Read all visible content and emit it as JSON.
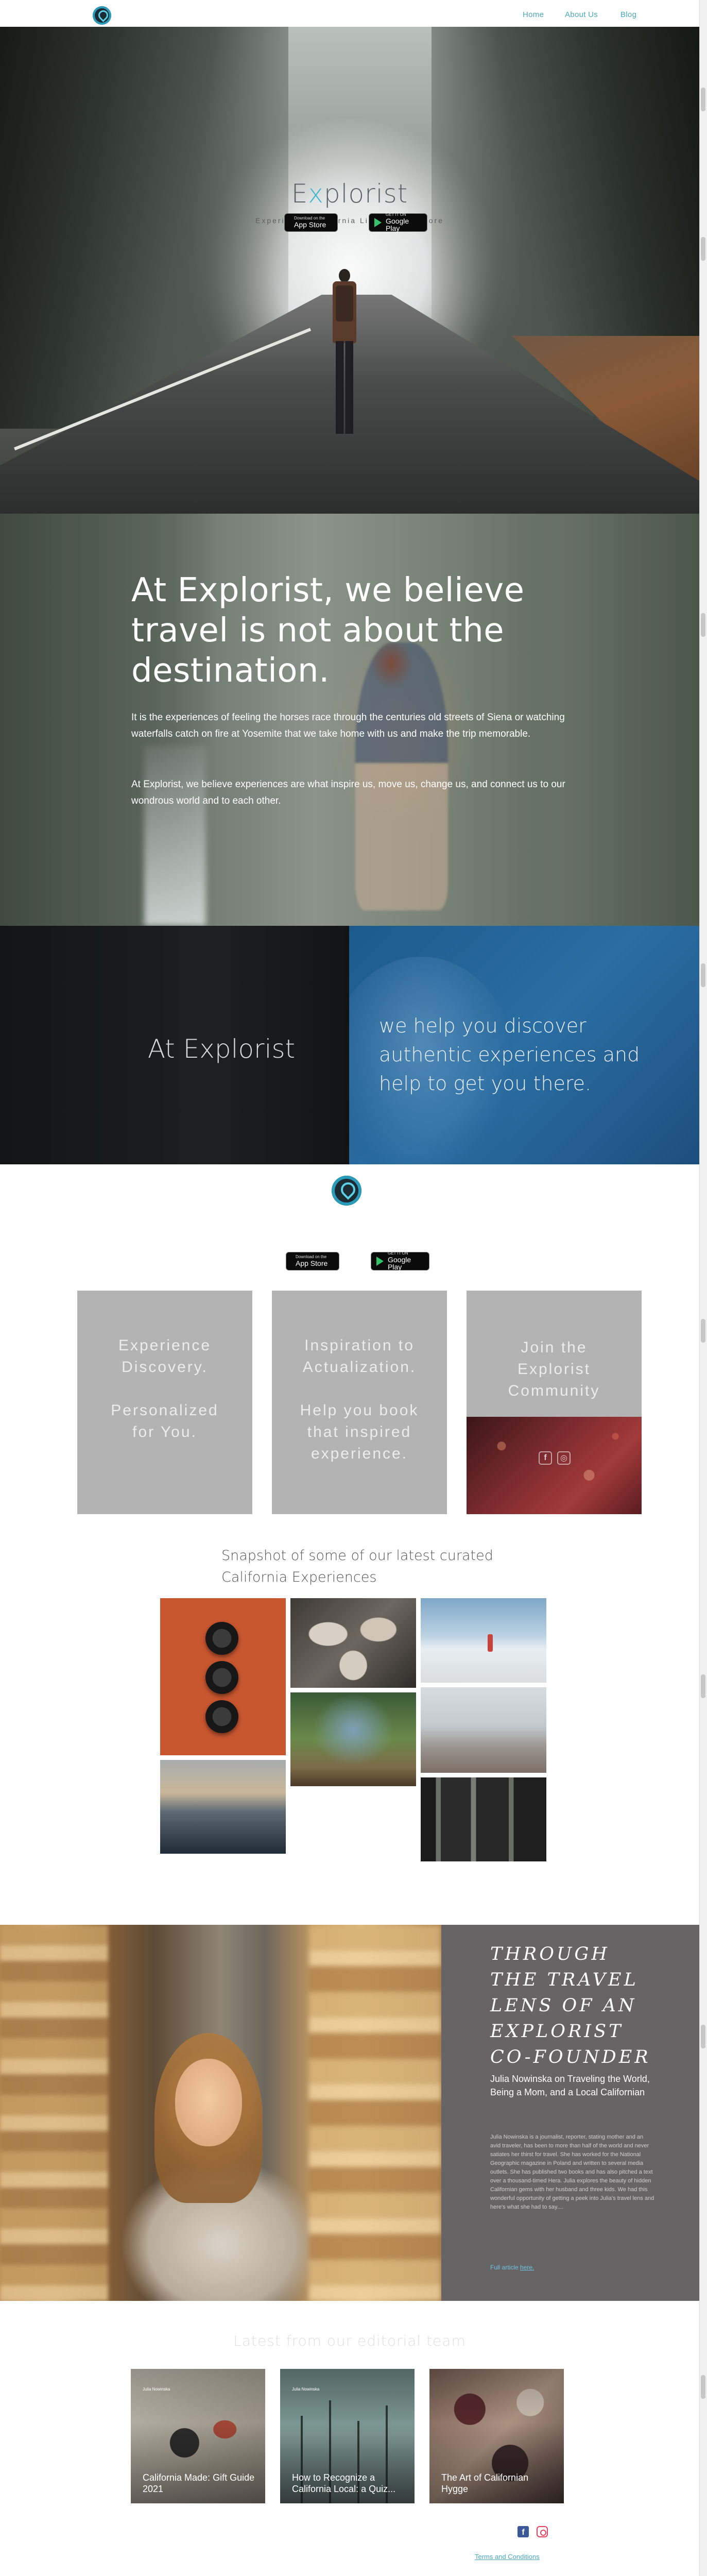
{
  "header": {
    "logo_alt": "Explorist logo",
    "nav": [
      "Home",
      "About Us",
      "Blog"
    ]
  },
  "hero": {
    "title_prefix": "E",
    "title_accent": "x",
    "title_suffix": "plorist",
    "subtitle": "Experience California Like Never Before",
    "app_store": {
      "small": "Download on the",
      "big": "App Store"
    },
    "google_play": {
      "small": "GET IT ON",
      "big": "Google Play"
    }
  },
  "belief": {
    "heading": "At Explorist, we believe travel is not about the destination.",
    "paragraph_1": "It is the experiences of feeling the horses race through the centuries old streets of Siena or watching waterfalls catch on fire at Yosemite that we take home with us and make the trip memorable.",
    "paragraph_2": "At Explorist, we believe experiences are what inspire us, move us, change us, and connect us to our wondrous world and to each other."
  },
  "split": {
    "left": "At Explorist",
    "right": "we help you discover authentic experiences and help to get you there."
  },
  "badges": {
    "app_store": {
      "small": "Download on the",
      "big": "App Store"
    },
    "google_play": {
      "small": "GET IT ON",
      "big": "Google Play"
    }
  },
  "cards": [
    {
      "line1": "Experience",
      "line2": "Discovery.",
      "line3": "Personalized",
      "line4": "for You."
    },
    {
      "line1": "Inspiration to",
      "line2": "Actualization.",
      "line3": "Help you book",
      "line4": "that inspired",
      "line5": "experience."
    },
    {
      "line1": "Join the",
      "line2": "Explorist",
      "line3": "Community"
    }
  ],
  "snapshot": {
    "title": "Snapshot of some of our latest curated California Experiences"
  },
  "founder": {
    "heading": "THROUGH THE TRAVEL LENS OF AN EXPLORIST CO-FOUNDER",
    "subheading": "Julia Nowinska on Traveling the World, Being a Mom, and a Local Californian",
    "body": "Julia Nowinska is a journalist, reporter, stating mother and an avid traveler, has been to more than half of the world and never satiates her thirst for travel. She has worked for the National Geographic magazine in Poland and written to several media outlets. She has published two books and has also pitched a text over a thousand-timed Hera. Julia explores the beauty of hidden Californian gems with her husband and three kids. We had this wonderful opportunity of getting a peek into Julia's travel lens and here's what she had to say....",
    "more_prefix": "Full article ",
    "more_link": "here."
  },
  "editorial": {
    "title": "Latest from our editorial team",
    "posts": [
      {
        "author": "Julia Nowinska",
        "title": "California Made: Gift Guide 2021"
      },
      {
        "author": "Julia Nowinska",
        "title": "How to Recognize a California Local: a Quiz..."
      },
      {
        "author": "",
        "title": "The Art of Californian Hygge"
      }
    ]
  },
  "footer": {
    "terms": "Terms and Conditions"
  },
  "colors": {
    "accent": "#3fb5d0",
    "nav_link": "#4aa8c0",
    "card_gray": "#b3b3b3",
    "founder_panel": "#666464",
    "split_blue": "#2b6ea3"
  },
  "icons": [
    "explorist-logo-icon",
    "apple-icon",
    "google-play-icon",
    "facebook-icon",
    "instagram-icon"
  ]
}
